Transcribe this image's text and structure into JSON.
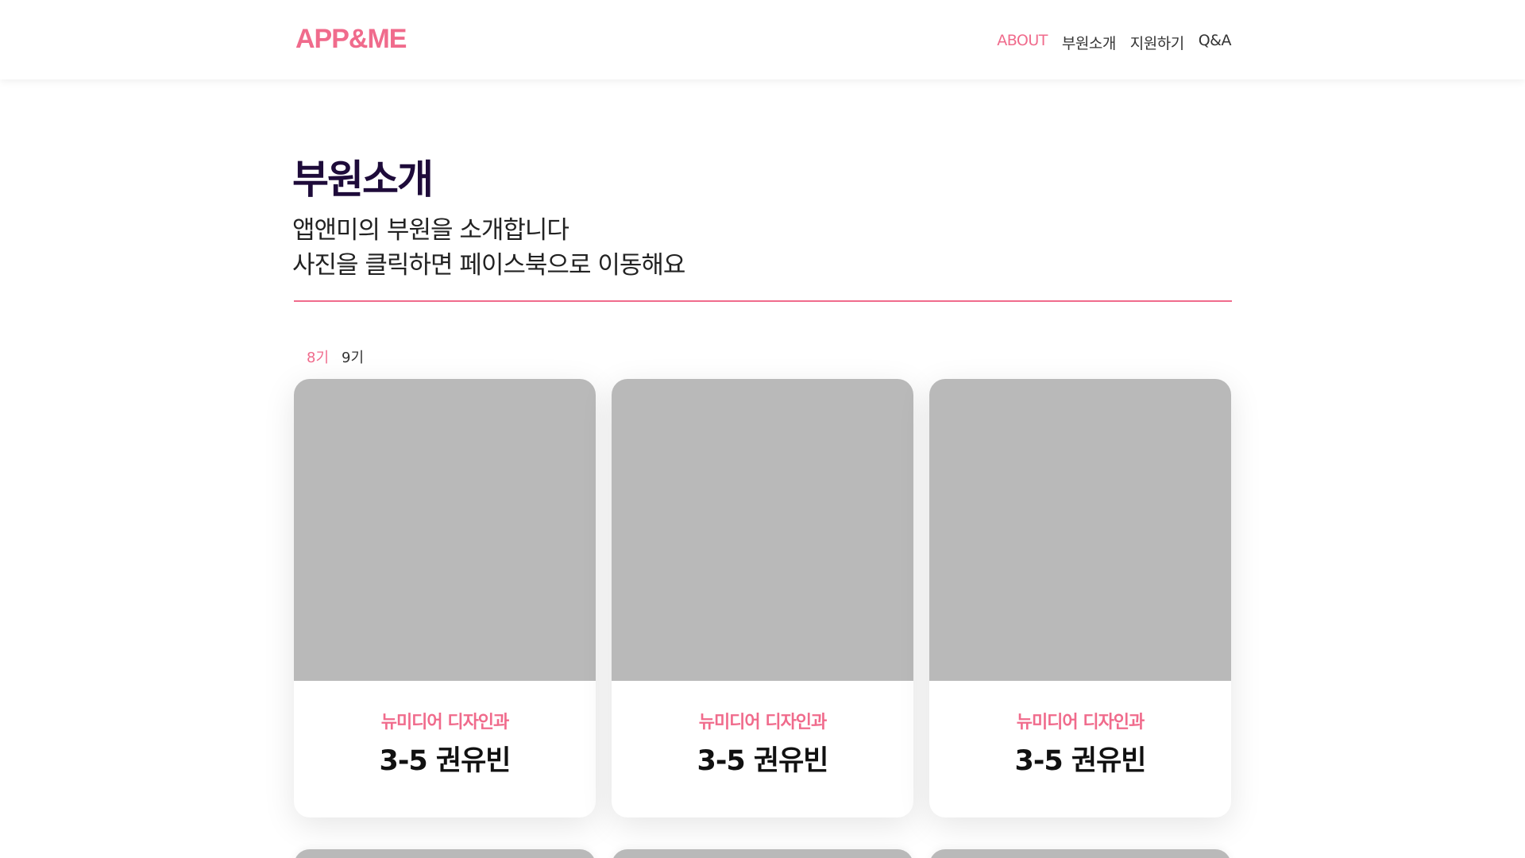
{
  "header": {
    "logo": "APP&ME",
    "nav": [
      {
        "label": "ABOUT",
        "active": true
      },
      {
        "label": "부원소개",
        "active": false
      },
      {
        "label": "지원하기",
        "active": false
      },
      {
        "label": "Q&A",
        "active": false
      }
    ]
  },
  "main": {
    "title": "부원소개",
    "subtitle_line1": "앱앤미의 부원을 소개합니다",
    "subtitle_line2": "사진을 클릭하면 페이스북으로 이동해요"
  },
  "generation_tabs": [
    {
      "label": "8기",
      "active": true
    },
    {
      "label": "9기",
      "active": false
    }
  ],
  "members": [
    {
      "major": "뉴미디어 디자인과",
      "name": "3-5 권유빈"
    },
    {
      "major": "뉴미디어 디자인과",
      "name": "3-5 권유빈"
    },
    {
      "major": "뉴미디어 디자인과",
      "name": "3-5 권유빈"
    }
  ],
  "colors": {
    "accent": "#f06b8c",
    "title": "#1e0b3a",
    "photo_placeholder": "#b9b9b9"
  }
}
